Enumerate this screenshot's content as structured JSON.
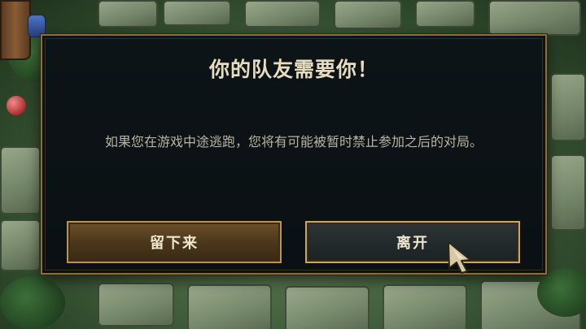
{
  "dialog": {
    "title": "你的队友需要你！",
    "message": "如果您在游戏中途逃跑，您将有可能被暂时禁止参加之后的对局。",
    "stay_label": "留下来",
    "leave_label": "离开"
  },
  "colors": {
    "border_gold": "#8a6f3c",
    "stay_button": "#5a4221",
    "leave_button": "#242c2e",
    "title_text": "#e8dcc0"
  },
  "icons": {
    "cursor": "game-pointer-icon"
  }
}
